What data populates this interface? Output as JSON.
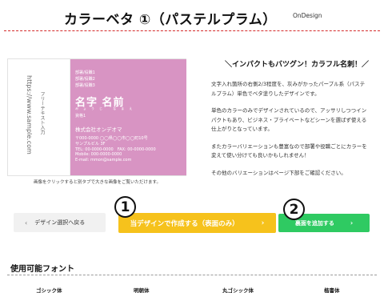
{
  "header": {
    "title": "カラーベタ ①（パステルプラム）",
    "brand": "OnDesign"
  },
  "card": {
    "back": {
      "url": "https://www.sample.com",
      "free_text": "フリーテキスト入力"
    },
    "front": {
      "dept1": "部署/役職1",
      "dept2": "部署/役職2",
      "dept3": "部署/役職3",
      "name": "名字 名前",
      "reading": "みょうじ なまえ",
      "qualification": "資格1",
      "company": "株式会社オンデオマ",
      "address1": "〒000-0000 ◯◯県◯◯市◯◯町10号",
      "address2": "サンプルビル 3F",
      "tel_fax": "TEL: 00-0000-0000　FAX: 00-0000-0000",
      "mobile": "Mobile: 000-0000-0000",
      "email": "E-mail: mmon@sample.com"
    },
    "caption": "画像をクリックすると別タブで大きな画像をご覧いただけます。"
  },
  "description": {
    "catch": "＼インパクトもバツグン！カラフル名刺！／",
    "paragraphs": [
      "文字入れ箇所の右側2/3程度を、灰みがかったパープル系（パステルプラム）単色でベタ塗りしたデザインです。",
      "単色のカラーのみでデザインされているので、アッサリしつつインパクトもあり、ビジネス・プライベートなどシーンを選ばず使える仕上がりとなっています。",
      "またカラーバリエーションも豊富なので部署や役職ごとにカラーを変えて使い分けても良いかもしれません！",
      "その他のバリエーションはページ下部をご確認ください。"
    ]
  },
  "buttons": {
    "back_label": "デザイン選択へ戻る",
    "create_label": "当デザインで作成する（表面のみ）",
    "add_back_label": "裏面を追加する",
    "chevron": "›",
    "back_chevron": "‹"
  },
  "badges": {
    "one": "1",
    "two": "2"
  },
  "fonts": {
    "heading": "使用可能フォント",
    "items": [
      "ゴシック体",
      "明朝体",
      "丸ゴシック体",
      "楷書体"
    ]
  },
  "colors": {
    "accent_red": "#d42a2a",
    "card_plum": "#d894c3",
    "create_yellow": "#f6c21c",
    "add_green": "#2fca62"
  }
}
